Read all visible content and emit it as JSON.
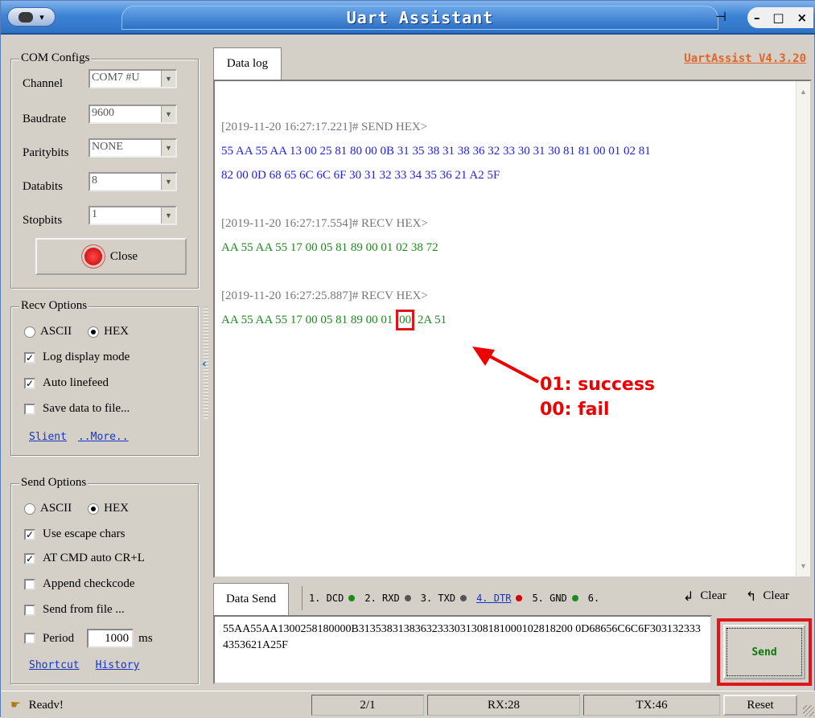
{
  "window": {
    "title": "Uart Assistant",
    "version": "UartAssist V4.3.20"
  },
  "com_configs": {
    "title": "COM Configs",
    "channel": {
      "label": "Channel",
      "value": "COM7 #U"
    },
    "baudrate": {
      "label": "Baudrate",
      "value": "9600"
    },
    "paritybits": {
      "label": "Paritybits",
      "value": "NONE"
    },
    "databits": {
      "label": "Databits",
      "value": "8"
    },
    "stopbits": {
      "label": "Stopbits",
      "value": "1"
    },
    "close_label": "Close"
  },
  "recv_options": {
    "title": "Recv Options",
    "ascii": "ASCII",
    "hex": "HEX",
    "selected": "HEX",
    "log_display": "Log display mode",
    "auto_linefeed": "Auto linefeed",
    "save_file": "Save data to file...",
    "link_slient": "Slient",
    "link_more": "..More.."
  },
  "send_options": {
    "title": "Send Options",
    "ascii": "ASCII",
    "hex": "HEX",
    "selected": "HEX",
    "escape": "Use escape chars",
    "at_cmd": "AT CMD auto CR+L",
    "checkcode": "Append checkcode",
    "send_file": "Send from file ...",
    "period": "Period",
    "period_value": "1000",
    "period_unit": "ms",
    "link_shortcut": "Shortcut",
    "link_history": "History"
  },
  "datalog": {
    "tab": "Data log",
    "entries": [
      {
        "ts": "[2019-11-20 16:27:17.221]# SEND HEX>",
        "lines": [
          "55 AA 55 AA 13 00 25 81 80 00 0B 31 35 38 31 38 36 32 33 30 31 30 81 81 00 01 02 81",
          "82 00 0D 68 65 6C 6C 6F 30 31 32 33 34 35 36 21 A2 5F"
        ]
      },
      {
        "ts": "[2019-11-20 16:27:17.554]# RECV HEX>",
        "lines": [
          "AA 55 AA 55 17 00 05 81 89 00 01 02 38 72"
        ]
      },
      {
        "ts": "[2019-11-20 16:27:25.887]# RECV HEX>",
        "prefix": "AA 55 AA 55 17 00 05 81 89 00 01 ",
        "highlight": "00",
        "suffix": " 2A 51"
      }
    ],
    "annotation": [
      "01: success",
      "00: fail"
    ]
  },
  "datasend": {
    "tab": "Data Send",
    "signals": [
      {
        "label": "1. DCD",
        "color": "#1a8a1a"
      },
      {
        "label": "2. RXD",
        "color": "#555555"
      },
      {
        "label": "3. TXD",
        "color": "#555555"
      },
      {
        "label": "4. DTR",
        "color": "#d40000"
      },
      {
        "label": "5. GND",
        "color": "#1a8a1a"
      },
      {
        "label": "6.",
        "color": ""
      }
    ],
    "clear1": "Clear",
    "clear2": "Clear",
    "text": "55AA55AA1300258180000B31353831383632333031308181000102818200 0D68656C6C6F3031323334353621A25F",
    "send": "Send"
  },
  "status": {
    "ready": "Readv!",
    "count": "2/1",
    "rx": "RX:28",
    "tx": "TX:46",
    "reset": "Reset"
  }
}
